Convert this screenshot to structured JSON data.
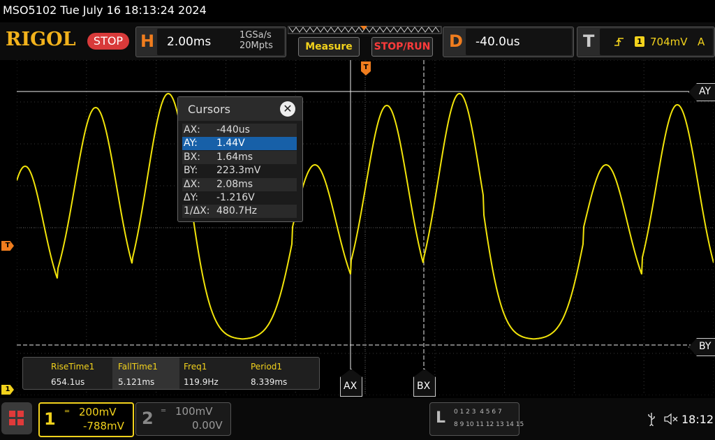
{
  "title_bar": {
    "text": "MSO5102  Tue July 16 18:13:24 2024"
  },
  "brand": {
    "logo": "RIGOL",
    "run_state": "STOP"
  },
  "horizontal": {
    "letter": "H",
    "timebase": "2.00ms",
    "sample_rate": "1GSa/s",
    "memory_depth": "20Mpts"
  },
  "buttons": {
    "measure": "Measure",
    "stop_run": "STOP/RUN"
  },
  "delay": {
    "letter": "D",
    "value": "-40.0us"
  },
  "trigger": {
    "letter": "T",
    "channel": "1",
    "level": "704mV",
    "mode": "A"
  },
  "cursor_labels": {
    "ay": "AY",
    "by": "BY",
    "ax": "AX",
    "bx": "BX"
  },
  "markers": {
    "trigger_level": "T",
    "channel1": "1"
  },
  "cursors_dialog": {
    "title": "Cursors",
    "close": "✕",
    "rows": [
      {
        "key": "AX:",
        "value": "-440us"
      },
      {
        "key": "AY:",
        "value": "1.44V"
      },
      {
        "key": "BX:",
        "value": "1.64ms"
      },
      {
        "key": "BY:",
        "value": "223.3mV"
      },
      {
        "key": "ΔX:",
        "value": "2.08ms"
      },
      {
        "key": "ΔY:",
        "value": "-1.216V"
      },
      {
        "key": "1/ΔX:",
        "value": "480.7Hz"
      }
    ]
  },
  "measurements": [
    {
      "name": "RiseTime1",
      "value": "654.1us"
    },
    {
      "name": "FallTime1",
      "value": "5.121ms"
    },
    {
      "name": "Freq1",
      "value": "119.9Hz"
    },
    {
      "name": "Period1",
      "value": "8.339ms"
    }
  ],
  "channels": {
    "ch1": {
      "number": "1",
      "scale": "200mV",
      "offset": "-788mV"
    },
    "ch2": {
      "number": "2",
      "scale": "100mV",
      "offset": "0.00V"
    }
  },
  "logic": {
    "letter": "L",
    "row1": "0 1 2 3  4 5 6 7",
    "row2": "8 9 10 11 12 13 14 15"
  },
  "status": {
    "time": "18:12"
  },
  "colors": {
    "ch1": "#f2e40a",
    "accent": "#f07d1e",
    "selected": "#1760a8"
  }
}
